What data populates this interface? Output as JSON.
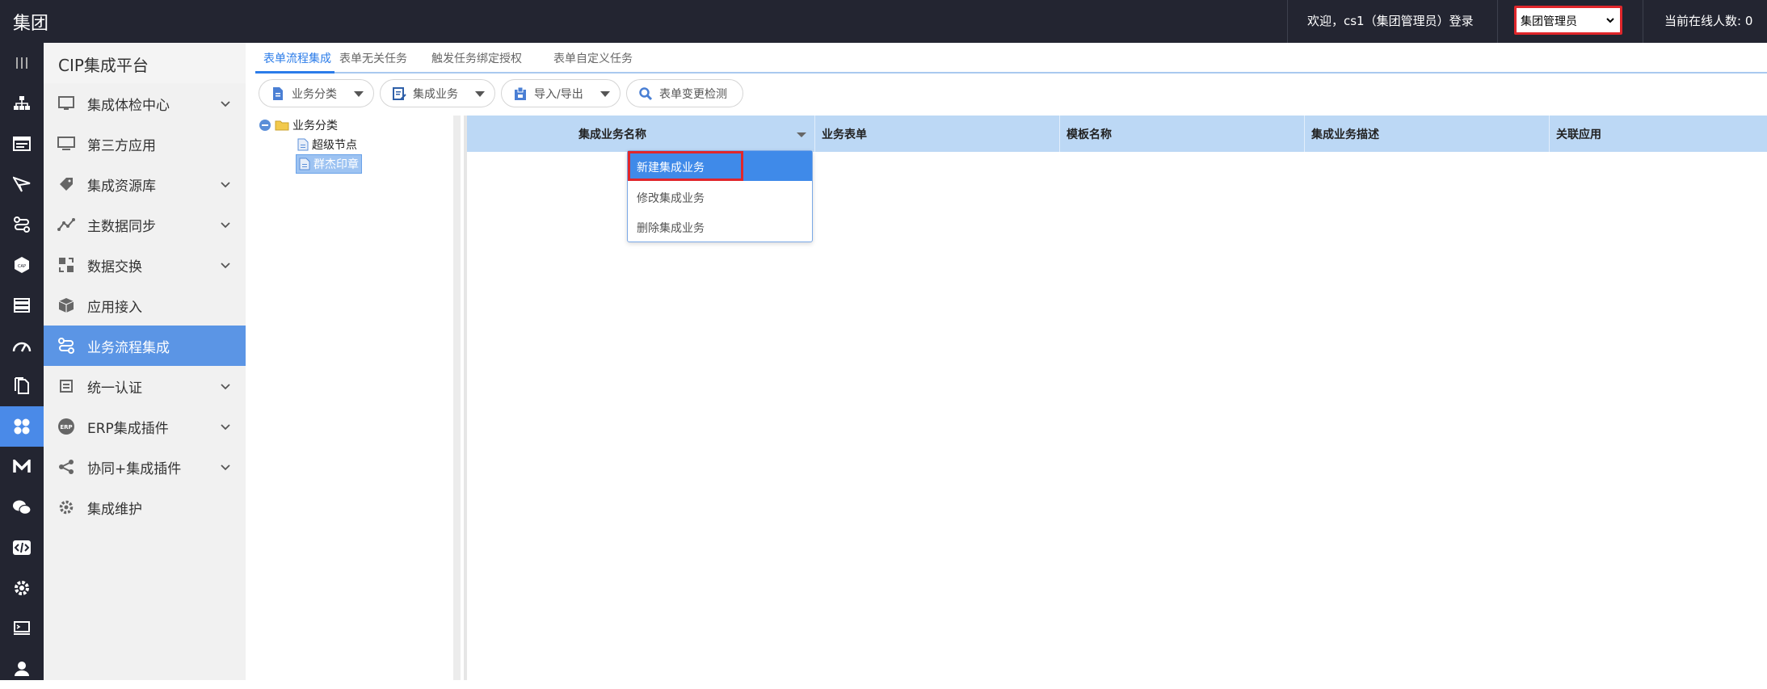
{
  "topbar": {
    "brand": "集团",
    "welcome": "欢迎，cs1（集团管理员）登录",
    "role_select": {
      "value": "集团管理员"
    },
    "online": "当前在线人数: 0"
  },
  "leftbar": {
    "icons": [
      "menu-icon",
      "org-chart-icon",
      "form-icon",
      "send-icon",
      "flow-icon",
      "cap-icon",
      "stack-icon",
      "gauge-icon",
      "document-icon",
      "apps-icon",
      "mail-m-icon",
      "wechat-icon",
      "code-icon",
      "gear-icon",
      "terminal-icon",
      "user-icon"
    ],
    "active_index": 9
  },
  "sidebar": {
    "title": "CIP集成平台",
    "items": [
      {
        "label": "集成体检中心",
        "icon": "checkup-icon",
        "expandable": true
      },
      {
        "label": "第三方应用",
        "icon": "monitor-icon",
        "expandable": false
      },
      {
        "label": "集成资源库",
        "icon": "tag-icon",
        "expandable": true
      },
      {
        "label": "主数据同步",
        "icon": "line-chart-icon",
        "expandable": true
      },
      {
        "label": "数据交换",
        "icon": "exchange-icon",
        "expandable": true
      },
      {
        "label": "应用接入",
        "icon": "cube-icon",
        "expandable": false
      },
      {
        "label": "业务流程集成",
        "icon": "flow-icon",
        "expandable": false,
        "active": true
      },
      {
        "label": "统一认证",
        "icon": "auth-icon",
        "expandable": true
      },
      {
        "label": "ERP集成插件",
        "icon": "erp-icon",
        "expandable": true
      },
      {
        "label": "协同+集成插件",
        "icon": "share-icon",
        "expandable": true
      },
      {
        "label": "集成维护",
        "icon": "gear-icon",
        "expandable": false
      }
    ]
  },
  "tabs": [
    {
      "label": "表单流程集成",
      "active": true
    },
    {
      "label": "表单无关任务"
    },
    {
      "label": "触发任务绑定授权"
    },
    {
      "label": "表单自定义任务"
    }
  ],
  "toolbar": {
    "category_label": "业务分类",
    "integration_label": "集成业务",
    "import_export_label": "导入/导出",
    "detect_label": "表单变更检测"
  },
  "tree": {
    "root": "业务分类",
    "children": [
      "超级节点",
      "群杰印章"
    ],
    "selected_index": 1
  },
  "grid": {
    "columns": [
      "集成业务名称",
      "业务表单",
      "模板名称",
      "集成业务描述",
      "关联应用"
    ]
  },
  "dropdown": {
    "items": [
      "新建集成业务",
      "修改集成业务",
      "删除集成业务"
    ],
    "highlight_index": 0
  },
  "colors": {
    "topbar_bg": "#232531",
    "accent": "#2b7ce9",
    "sidebar_active": "#5b95e5",
    "grid_header": "#bcd8f5",
    "highlight_red": "#e0262b"
  }
}
